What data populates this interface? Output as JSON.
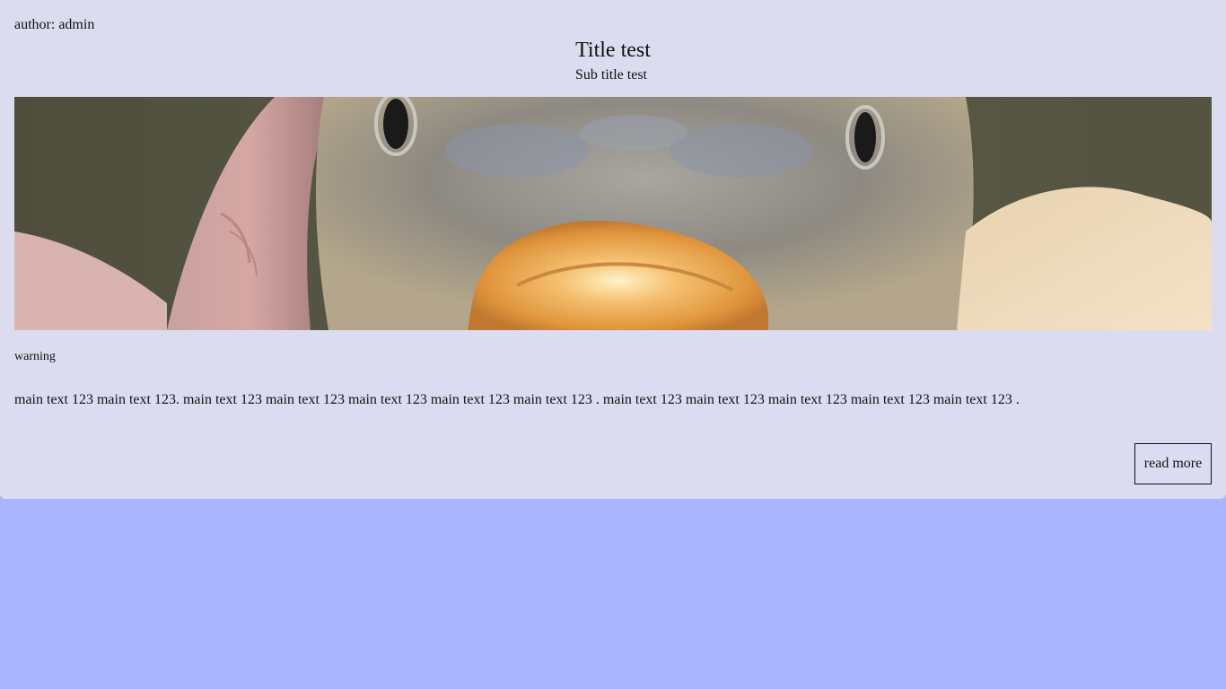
{
  "post": {
    "author": "author: admin",
    "title": "Title test",
    "subtitle": "Sub title test",
    "warning": "warning",
    "main_text": "main text 123 main text 123. main text 123 main text 123 main text 123 main text 123 main text 123 . main text 123 main text 123 main text 123 main text 123 main text 123 .",
    "read_more_label": "read more"
  },
  "colors": {
    "page_background": "#abb4ff",
    "card_background": "#dcdcf0",
    "text": "#111111"
  }
}
